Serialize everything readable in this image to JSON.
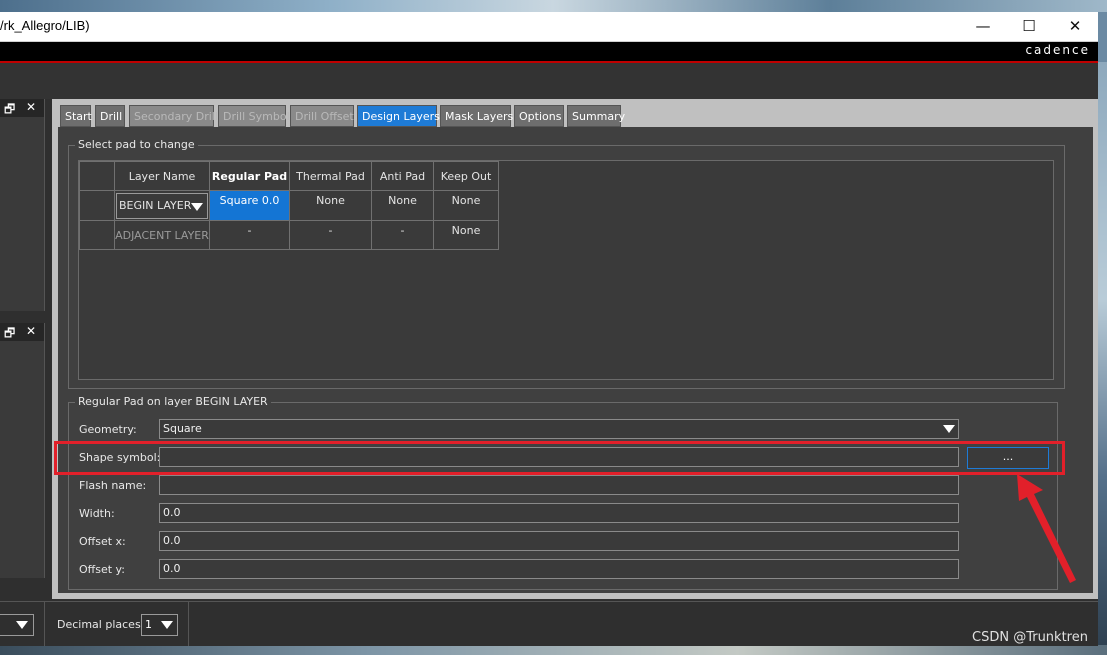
{
  "window": {
    "title": "/rk_Allegro/LIB)",
    "minimize": "—",
    "maximize": "☐",
    "close": "✕",
    "brand": "cadence"
  },
  "side_panels": [
    {
      "restore_icon": "🗗",
      "close_icon": "✕"
    },
    {
      "restore_icon": "🗗",
      "close_icon": "✕"
    }
  ],
  "tabs": [
    {
      "label": "Start",
      "state": "normal"
    },
    {
      "label": "Drill",
      "state": "normal"
    },
    {
      "label": "Secondary Drill",
      "state": "disabled"
    },
    {
      "label": "Drill Symbol",
      "state": "disabled"
    },
    {
      "label": "Drill Offset",
      "state": "disabled"
    },
    {
      "label": "Design Layers",
      "state": "active"
    },
    {
      "label": "Mask Layers",
      "state": "normal"
    },
    {
      "label": "Options",
      "state": "normal"
    },
    {
      "label": "Summary",
      "state": "normal"
    }
  ],
  "select_pad": {
    "group_title": "Select pad to change",
    "columns": [
      "Layer Name",
      "Regular Pad",
      "Thermal Pad",
      "Anti Pad",
      "Keep Out"
    ],
    "rows": [
      {
        "layer": "BEGIN LAYER",
        "regular": "Square 0.0",
        "thermal": "None",
        "anti": "None",
        "keepout": "None"
      },
      {
        "layer": "ADJACENT LAYER",
        "regular": "-",
        "thermal": "-",
        "anti": "-",
        "keepout": "None"
      }
    ]
  },
  "regular_pad": {
    "group_title": "Regular Pad on layer BEGIN LAYER",
    "geometry_label": "Geometry:",
    "geometry_value": "Square",
    "shape_symbol_label": "Shape symbol:",
    "shape_symbol_value": "",
    "browse_button": "...",
    "flash_name_label": "Flash name:",
    "flash_name_value": "",
    "width_label": "Width:",
    "width_value": "0.0",
    "offset_x_label": "Offset x:",
    "offset_x_value": "0.0",
    "offset_y_label": "Offset y:",
    "offset_y_value": "0.0"
  },
  "statusbar": {
    "decimal_label": "Decimal places:",
    "decimal_value": "1"
  },
  "watermark": "CSDN @Trunktren",
  "colors": {
    "accent": "#1e7bd6",
    "highlight": "#e2202a",
    "brand_rule": "#c00000"
  }
}
